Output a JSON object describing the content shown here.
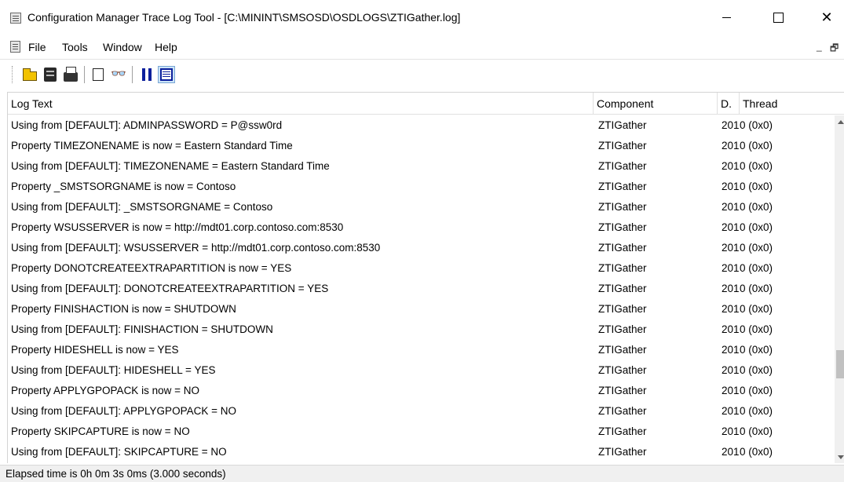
{
  "window": {
    "title": "Configuration Manager Trace Log Tool - [C:\\MININT\\SMSOSD\\OSDLOGS\\ZTIGather.log]",
    "close_glyph": "✕"
  },
  "menu": {
    "items": [
      "File",
      "Tools",
      "Window",
      "Help"
    ],
    "mdi_minimize": "_",
    "mdi_restore": "🗗",
    "mdi_close": "×"
  },
  "toolbar": {
    "buttons": [
      "open-icon",
      "server-icon",
      "print-icon",
      "copy-icon",
      "find-icon",
      "pause-icon",
      "log-view-icon"
    ],
    "find_glyph": "👓"
  },
  "grid": {
    "columns": [
      "Log Text",
      "Component",
      "D.",
      "Thread"
    ],
    "rows": [
      {
        "text": "Using from [DEFAULT]: ADMINPASSWORD = P@ssw0rd",
        "component": "ZTIGather",
        "date": "201",
        "thread": "0 (0x0)"
      },
      {
        "text": "Property TIMEZONENAME is now = Eastern Standard Time",
        "component": "ZTIGather",
        "date": "201",
        "thread": "0 (0x0)"
      },
      {
        "text": "Using from [DEFAULT]: TIMEZONENAME = Eastern Standard Time",
        "component": "ZTIGather",
        "date": "201",
        "thread": "0 (0x0)"
      },
      {
        "text": "Property _SMSTSORGNAME is now = Contoso",
        "component": "ZTIGather",
        "date": "201",
        "thread": "0 (0x0)"
      },
      {
        "text": "Using from [DEFAULT]: _SMSTSORGNAME = Contoso",
        "component": "ZTIGather",
        "date": "201",
        "thread": "0 (0x0)"
      },
      {
        "text": "Property WSUSSERVER is now = http://mdt01.corp.contoso.com:8530",
        "component": "ZTIGather",
        "date": "201",
        "thread": "0 (0x0)"
      },
      {
        "text": "Using from [DEFAULT]: WSUSSERVER = http://mdt01.corp.contoso.com:8530",
        "component": "ZTIGather",
        "date": "201",
        "thread": "0 (0x0)"
      },
      {
        "text": "Property DONOTCREATEEXTRAPARTITION is now = YES",
        "component": "ZTIGather",
        "date": "201",
        "thread": "0 (0x0)"
      },
      {
        "text": "Using from [DEFAULT]: DONOTCREATEEXTRAPARTITION = YES",
        "component": "ZTIGather",
        "date": "201",
        "thread": "0 (0x0)"
      },
      {
        "text": "Property FINISHACTION is now = SHUTDOWN",
        "component": "ZTIGather",
        "date": "201",
        "thread": "0 (0x0)"
      },
      {
        "text": "Using from [DEFAULT]: FINISHACTION = SHUTDOWN",
        "component": "ZTIGather",
        "date": "201",
        "thread": "0 (0x0)"
      },
      {
        "text": "Property HIDESHELL is now = YES",
        "component": "ZTIGather",
        "date": "201",
        "thread": "0 (0x0)"
      },
      {
        "text": "Using from [DEFAULT]: HIDESHELL = YES",
        "component": "ZTIGather",
        "date": "201",
        "thread": "0 (0x0)"
      },
      {
        "text": "Property APPLYGPOPACK is now = NO",
        "component": "ZTIGather",
        "date": "201",
        "thread": "0 (0x0)"
      },
      {
        "text": "Using from [DEFAULT]: APPLYGPOPACK = NO",
        "component": "ZTIGather",
        "date": "201",
        "thread": "0 (0x0)"
      },
      {
        "text": "Property SKIPCAPTURE is now = NO",
        "component": "ZTIGather",
        "date": "201",
        "thread": "0 (0x0)"
      },
      {
        "text": "Using from [DEFAULT]: SKIPCAPTURE = NO",
        "component": "ZTIGather",
        "date": "201",
        "thread": "0 (0x0)"
      }
    ]
  },
  "status": {
    "text": "Elapsed time is 0h 0m 3s 0ms (3.000 seconds)"
  }
}
